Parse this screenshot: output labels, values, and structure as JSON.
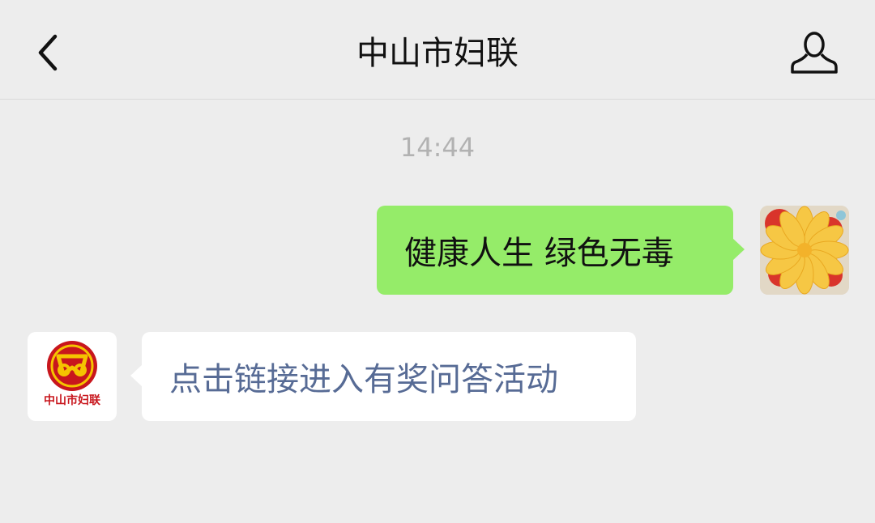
{
  "header": {
    "title": "中山市妇联",
    "back_icon": "chevron-left-icon",
    "profile_icon": "person-icon"
  },
  "chat": {
    "timestamp": "14:44",
    "messages": [
      {
        "direction": "outgoing",
        "text": "健康人生 绿色无毒",
        "avatar_icon": "flower-icon"
      },
      {
        "direction": "incoming",
        "text": "点击链接进入有奖问答活动",
        "avatar_icon": "womens-federation-logo",
        "avatar_logo_text": "中山市妇联"
      }
    ]
  },
  "colors": {
    "background": "#ededed",
    "outgoing_bubble": "#95ec69",
    "incoming_bubble": "#ffffff",
    "link_text": "#576b95",
    "timestamp": "#b2b2b2",
    "logo_red": "#c8161d",
    "logo_yellow": "#f5c400"
  }
}
